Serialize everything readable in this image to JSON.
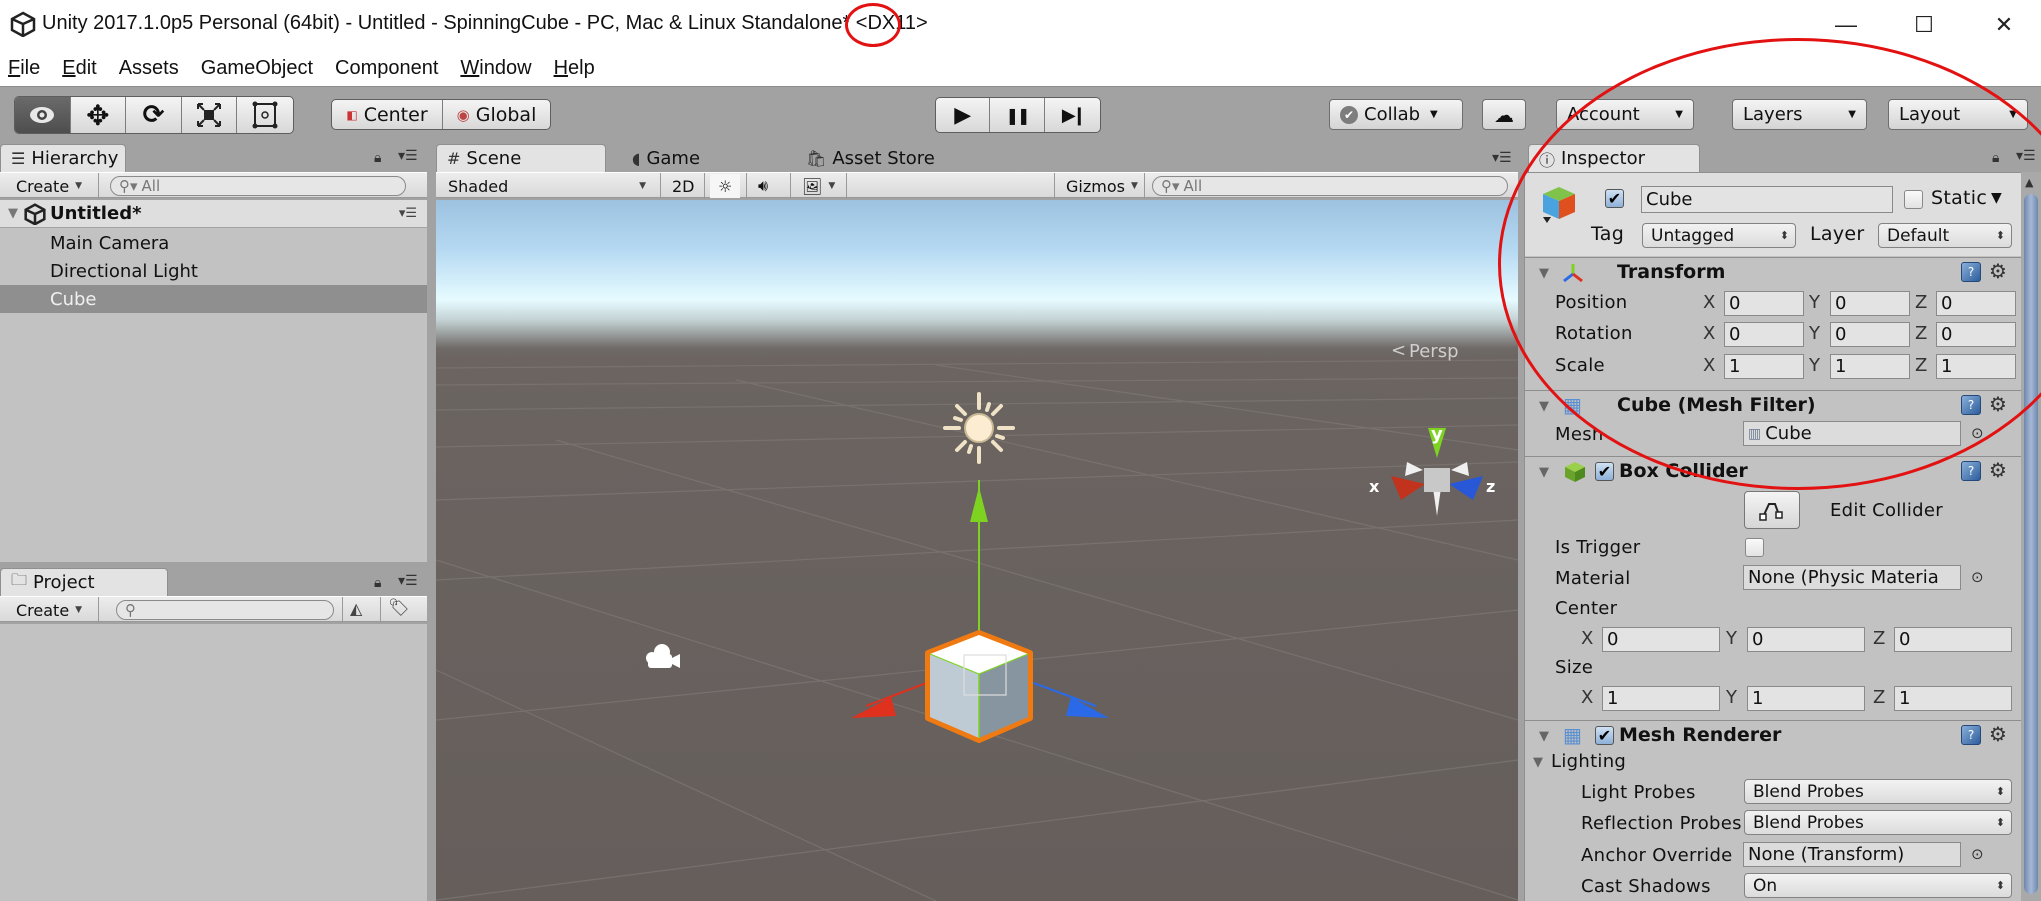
{
  "window": {
    "title": "Unity 2017.1.0p5 Personal (64bit) - Untitled - SpinningCube - PC, Mac & Linux Standalone* <DX11>",
    "controls": {
      "minimize": "—",
      "maximize": "☐",
      "close": "✕"
    }
  },
  "menu": [
    {
      "label": "File",
      "mnemonic": "F",
      "rest": "ile"
    },
    {
      "label": "Edit",
      "mnemonic": "E",
      "rest": "dit"
    },
    {
      "label": "Assets",
      "mnemonic": "",
      "rest": "Assets"
    },
    {
      "label": "GameObject",
      "mnemonic": "",
      "rest": "GameObject"
    },
    {
      "label": "Component",
      "mnemonic": "",
      "rest": "Component"
    },
    {
      "label": "Window",
      "mnemonic": "W",
      "rest": "indow"
    },
    {
      "label": "Help",
      "mnemonic": "H",
      "rest": "elp"
    }
  ],
  "toolbar": {
    "transform_tools": [
      "view-tool",
      "move-tool",
      "rotate-tool",
      "scale-tool",
      "rect-tool"
    ],
    "pivot_mode": "Center",
    "pivot_rotation": "Global",
    "play": "▶",
    "pause": "❚❚",
    "step": "▶❙",
    "collab": "Collab",
    "account": "Account",
    "layers": "Layers",
    "layout": "Layout"
  },
  "hierarchy": {
    "tab": "Hierarchy",
    "create": "Create",
    "search_placeholder": "All",
    "scene": "Untitled*",
    "items": [
      {
        "label": "Main Camera",
        "selected": false
      },
      {
        "label": "Directional Light",
        "selected": false
      },
      {
        "label": "Cube",
        "selected": true
      }
    ]
  },
  "project": {
    "tab": "Project",
    "create": "Create",
    "search_placeholder": ""
  },
  "scene_view": {
    "tabs": [
      "Scene",
      "Game",
      "Asset Store"
    ],
    "active_tab": "Scene",
    "draw_mode": "Shaded",
    "mode_2d": "2D",
    "gizmos": "Gizmos",
    "search_placeholder": "All",
    "persp_label": "Persp",
    "gizmo_axes": {
      "x": "x",
      "y": "y",
      "z": "z"
    }
  },
  "inspector": {
    "tab": "Inspector",
    "object": {
      "active": true,
      "name": "Cube",
      "static_label": "Static",
      "static": false,
      "tag_label": "Tag",
      "tag": "Untagged",
      "layer_label": "Layer",
      "layer": "Default"
    },
    "transform": {
      "title": "Transform",
      "rows": [
        {
          "label": "Position",
          "x": "0",
          "y": "0",
          "z": "0"
        },
        {
          "label": "Rotation",
          "x": "0",
          "y": "0",
          "z": "0"
        },
        {
          "label": "Scale",
          "x": "1",
          "y": "1",
          "z": "1"
        }
      ]
    },
    "mesh_filter": {
      "title": "Cube (Mesh Filter)",
      "mesh_label": "Mesh",
      "mesh": "Cube"
    },
    "box_collider": {
      "title": "Box Collider",
      "enabled": true,
      "edit_collider": "Edit Collider",
      "is_trigger_label": "Is Trigger",
      "is_trigger": false,
      "material_label": "Material",
      "material": "None (Physic Materia",
      "center_label": "Center",
      "center": {
        "x": "0",
        "y": "0",
        "z": "0"
      },
      "size_label": "Size",
      "size": {
        "x": "1",
        "y": "1",
        "z": "1"
      }
    },
    "mesh_renderer": {
      "title": "Mesh Renderer",
      "enabled": true,
      "lighting_label": "Lighting",
      "light_probes_label": "Light Probes",
      "light_probes": "Blend Probes",
      "reflection_probes_label": "Reflection Probes",
      "reflection_probes": "Blend Probes",
      "anchor_override_label": "Anchor Override",
      "anchor_override": "None (Transform)",
      "cast_shadows_label": "Cast Shadows",
      "cast_shadows": "On"
    }
  },
  "axis_labels": {
    "x": "X",
    "y": "Y",
    "z": "Z"
  },
  "colors": {
    "annotation": "#e31212",
    "selection_outline": "#f07a12",
    "axis_x": "#e0301e",
    "axis_y": "#7ed321",
    "axis_z": "#2a6ae8"
  }
}
